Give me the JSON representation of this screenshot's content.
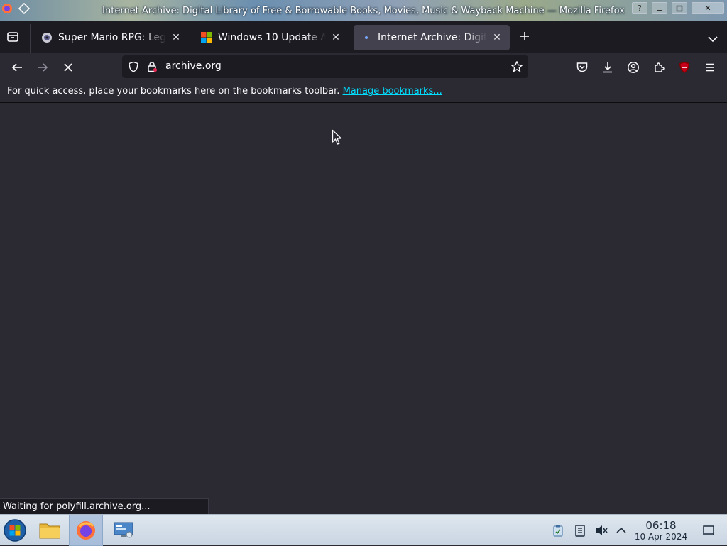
{
  "window": {
    "title": "Internet Archive: Digital Library of Free & Borrowable Books, Movies, Music & Wayback Machine — Mozilla Firefox",
    "help_label": "?",
    "close_label": "✕"
  },
  "tabs": [
    {
      "label": "Super Mario RPG: Legend of the Seven Stars",
      "icon": "disc-icon",
      "active": false
    },
    {
      "label": "Windows 10 Update Assistant",
      "icon": "windows-logo-icon",
      "active": false
    },
    {
      "label": "Internet Archive: Digital Library",
      "icon": "loading-dot-icon",
      "active": true
    }
  ],
  "navbar": {
    "url": "archive.org"
  },
  "bookmarks_bar": {
    "message": "For quick access, place your bookmarks here on the bookmarks toolbar.",
    "link": "Manage bookmarks..."
  },
  "status_text": "Waiting for polyfill.archive.org...",
  "taskbar": {
    "time": "06:18",
    "date": "10 Apr 2024"
  },
  "colors": {
    "accent_link": "#00ddff",
    "toolbar_bg": "#2b2a33",
    "tabstrip_bg": "#1c1b22"
  }
}
